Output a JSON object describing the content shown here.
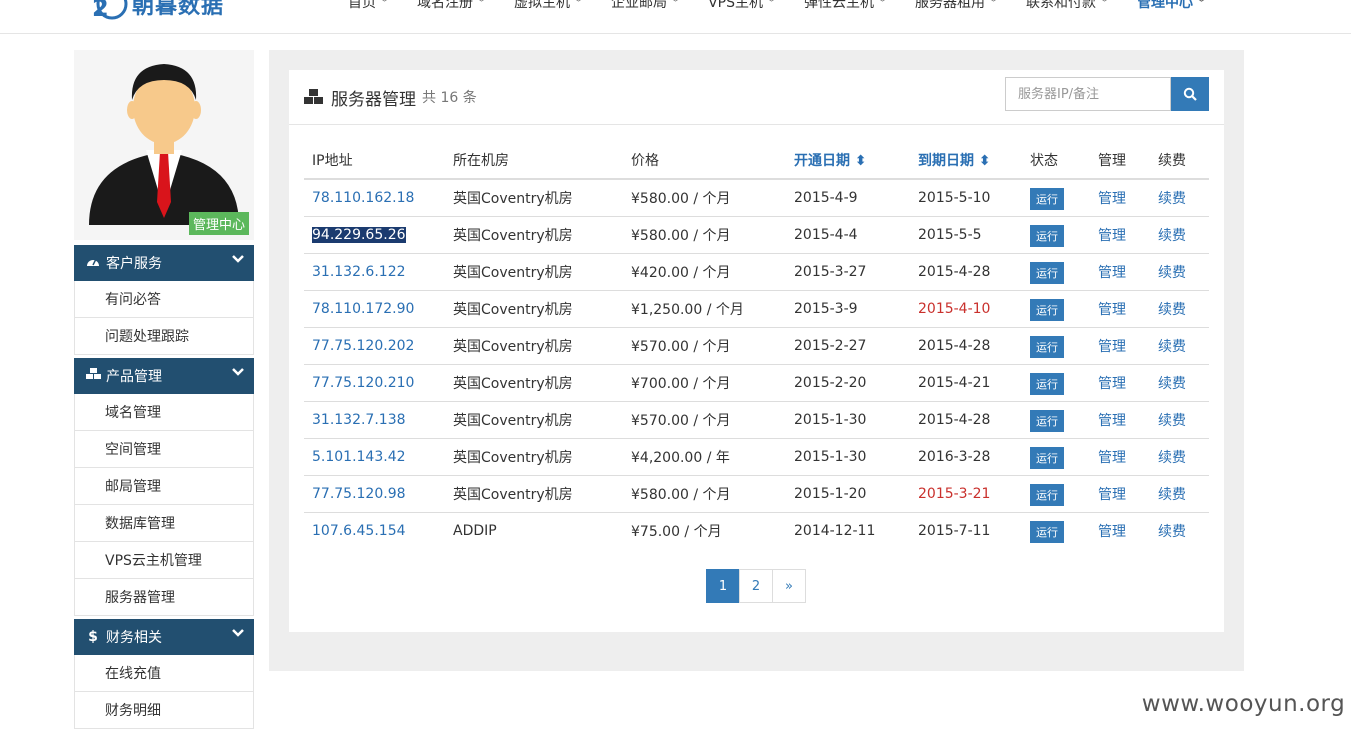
{
  "brand": {
    "name": "朝暮数据"
  },
  "nav": {
    "items": [
      {
        "label": "首页"
      },
      {
        "label": "域名注册"
      },
      {
        "label": "虚拟主机"
      },
      {
        "label": "企业邮局"
      },
      {
        "label": "VPS主机"
      },
      {
        "label": "弹性云主机"
      },
      {
        "label": "服务器租用"
      },
      {
        "label": "联系和付款"
      },
      {
        "label": "管理中心"
      }
    ]
  },
  "sidebar": {
    "badge": "管理中心",
    "sections": [
      {
        "title": "客户服务",
        "icon": "dashboard-icon",
        "items": [
          "有问必答",
          "问题处理跟踪"
        ]
      },
      {
        "title": "产品管理",
        "icon": "cubes-icon",
        "items": [
          "域名管理",
          "空间管理",
          "邮局管理",
          "数据库管理",
          "VPS云主机管理",
          "服务器管理"
        ]
      },
      {
        "title": "财务相关",
        "icon": "dollar-icon",
        "items": [
          "在线充值",
          "财务明细"
        ]
      }
    ]
  },
  "panel": {
    "title": "服务器管理",
    "count": "共 16 条",
    "search_placeholder": "服务器IP/备注"
  },
  "table": {
    "headers": [
      "IP地址",
      "所在机房",
      "价格",
      "开通日期",
      "到期日期",
      "状态",
      "管理",
      "续费"
    ],
    "rows": [
      {
        "ip": "78.110.162.18",
        "room": "英国Coventry机房",
        "price": "¥580.00 / 个月",
        "start": "2015-4-9",
        "end": "2015-5-10",
        "status": "运行",
        "manage": "管理",
        "renew": "续费"
      },
      {
        "ip": "94.229.65.26",
        "room": "英国Coventry机房",
        "price": "¥580.00 / 个月",
        "start": "2015-4-4",
        "end": "2015-5-5",
        "status": "运行",
        "manage": "管理",
        "renew": "续费"
      },
      {
        "ip": "31.132.6.122",
        "room": "英国Coventry机房",
        "price": "¥420.00 / 个月",
        "start": "2015-3-27",
        "end": "2015-4-28",
        "status": "运行",
        "manage": "管理",
        "renew": "续费"
      },
      {
        "ip": "78.110.172.90",
        "room": "英国Coventry机房",
        "price": "¥1,250.00 / 个月",
        "start": "2015-3-9",
        "end": "2015-4-10",
        "status": "运行",
        "manage": "管理",
        "renew": "续费"
      },
      {
        "ip": "77.75.120.202",
        "room": "英国Coventry机房",
        "price": "¥570.00 / 个月",
        "start": "2015-2-27",
        "end": "2015-4-28",
        "status": "运行",
        "manage": "管理",
        "renew": "续费"
      },
      {
        "ip": "77.75.120.210",
        "room": "英国Coventry机房",
        "price": "¥700.00 / 个月",
        "start": "2015-2-20",
        "end": "2015-4-21",
        "status": "运行",
        "manage": "管理",
        "renew": "续费"
      },
      {
        "ip": "31.132.7.138",
        "room": "英国Coventry机房",
        "price": "¥570.00 / 个月",
        "start": "2015-1-30",
        "end": "2015-4-28",
        "status": "运行",
        "manage": "管理",
        "renew": "续费"
      },
      {
        "ip": "5.101.143.42",
        "room": "英国Coventry机房",
        "price": "¥4,200.00 / 年",
        "start": "2015-1-30",
        "end": "2016-3-28",
        "status": "运行",
        "manage": "管理",
        "renew": "续费"
      },
      {
        "ip": "77.75.120.98",
        "room": "英国Coventry机房",
        "price": "¥580.00 / 个月",
        "start": "2015-1-20",
        "end": "2015-3-21",
        "status": "运行",
        "manage": "管理",
        "renew": "续费"
      },
      {
        "ip": "107.6.45.154",
        "room": "ADDIP",
        "price": "¥75.00 / 个月",
        "start": "2014-12-11",
        "end": "2015-7-11",
        "status": "运行",
        "manage": "管理",
        "renew": "续费"
      }
    ]
  },
  "pagination": {
    "pages": [
      "1",
      "2",
      "»"
    ],
    "current": "1"
  },
  "watermark": "www.wooyun.org",
  "colors": {
    "accent": "#337ab7",
    "sidebar_head": "#224f70",
    "badge": "#5cb85c",
    "expired": "#c9302c"
  }
}
